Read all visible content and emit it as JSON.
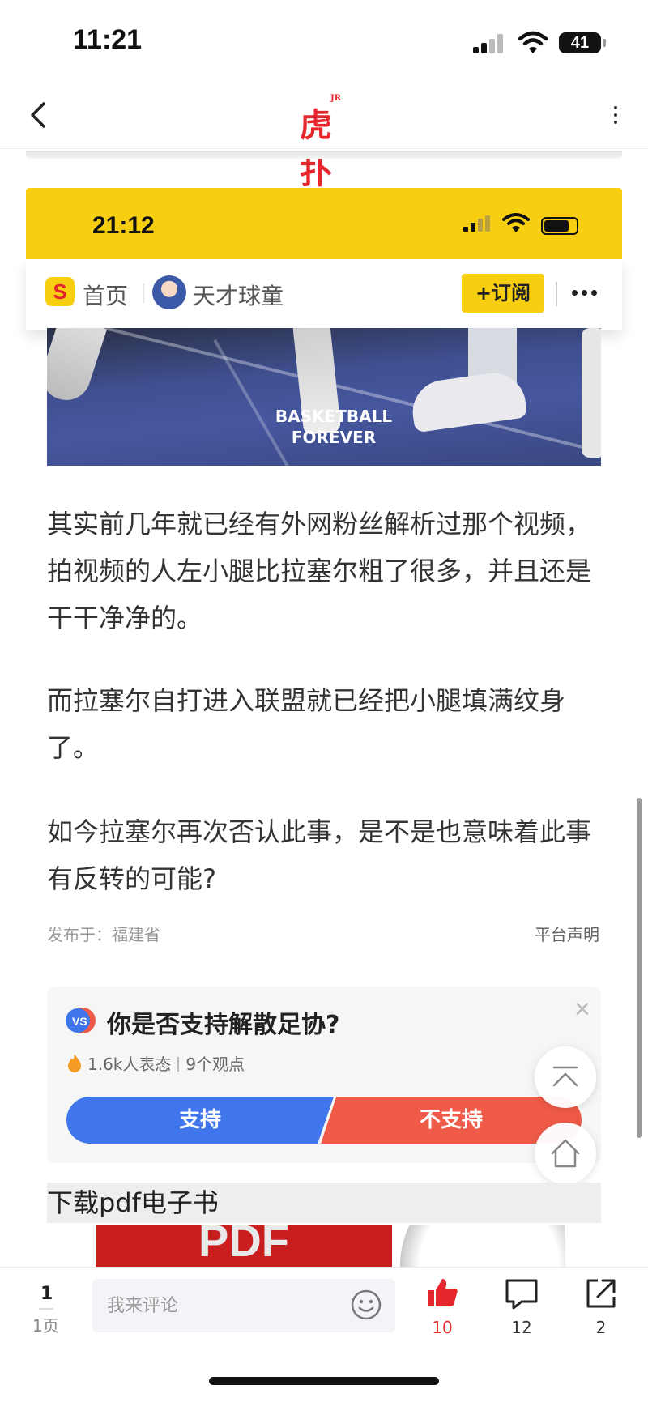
{
  "status_bar": {
    "time": "11:21",
    "battery": "41"
  },
  "app": {
    "logo_text": "虎扑",
    "logo_badge": "JR"
  },
  "embedded_screenshot": {
    "time": "21:12",
    "home_label": "首页",
    "author": "天才球童",
    "subscribe_label": "+订阅",
    "logo_letter": "S"
  },
  "photo": {
    "watermark_line1": "BASKETBALL",
    "watermark_line2": "FOREVER"
  },
  "article": {
    "paragraphs": [
      "其实前几年就已经有外网粉丝解析过那个视频，拍视频的人左小腿比拉塞尔粗了很多，并且还是干干净净的。",
      "而拉塞尔自打进入联盟就已经把小腿填满纹身了。",
      "如今拉塞尔再次否认此事，是不是也意味着此事有反转的可能?"
    ],
    "published_at": "发布于：福建省",
    "disclaimer": "平台声明"
  },
  "vote": {
    "question": "你是否支持解散足协?",
    "participants": "1.6k人表态",
    "opinions": "9个观点",
    "yes_label": "支持",
    "no_label": "不支持",
    "close_icon": "✕"
  },
  "pdf_ad": {
    "title": "下载pdf电子书",
    "image_text": "PDF"
  },
  "bottom_bar": {
    "page_current": "1",
    "page_label": "1页",
    "comment_placeholder": "我来评论",
    "likes": "10",
    "comments": "12",
    "shares": "2"
  },
  "colors": {
    "brand_red": "#e5262d",
    "accent_yellow": "#f8cf10",
    "vote_blue": "#3f76ec",
    "vote_red": "#f05a48"
  }
}
